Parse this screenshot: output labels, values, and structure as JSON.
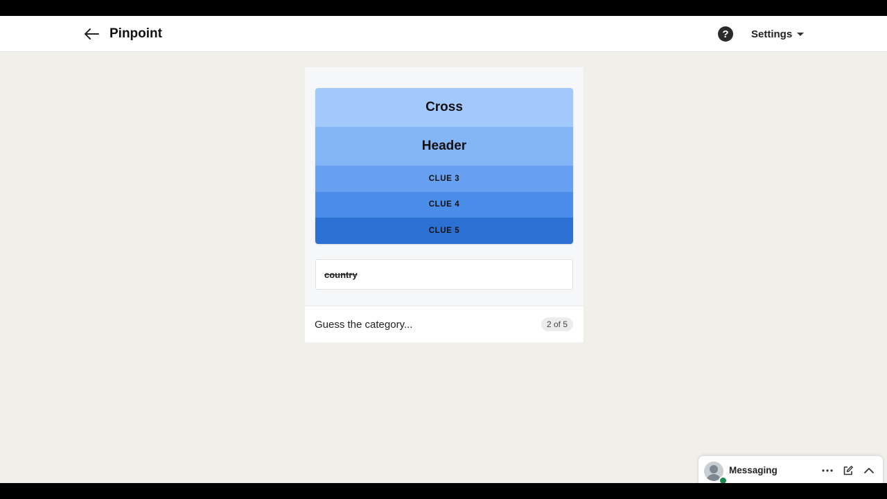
{
  "header": {
    "title": "Pinpoint",
    "settings_label": "Settings",
    "help_glyph": "?"
  },
  "game": {
    "clues": [
      {
        "label": "Cross",
        "state": "revealed",
        "color": "#a3c8fb"
      },
      {
        "label": "Header",
        "state": "revealed",
        "color": "#83b4f5"
      },
      {
        "label": "CLUE 3",
        "state": "hidden",
        "color": "#67a0f0"
      },
      {
        "label": "CLUE 4",
        "state": "hidden",
        "color": "#4a8eea"
      },
      {
        "label": "CLUE 5",
        "state": "hidden",
        "color": "#2d70d3"
      }
    ],
    "previous_guess": "country",
    "input_placeholder": "Guess the category...",
    "counter": "2 of 5"
  },
  "messaging": {
    "label": "Messaging",
    "icons": [
      "more-icon",
      "compose-icon",
      "chevron-up-icon"
    ]
  }
}
